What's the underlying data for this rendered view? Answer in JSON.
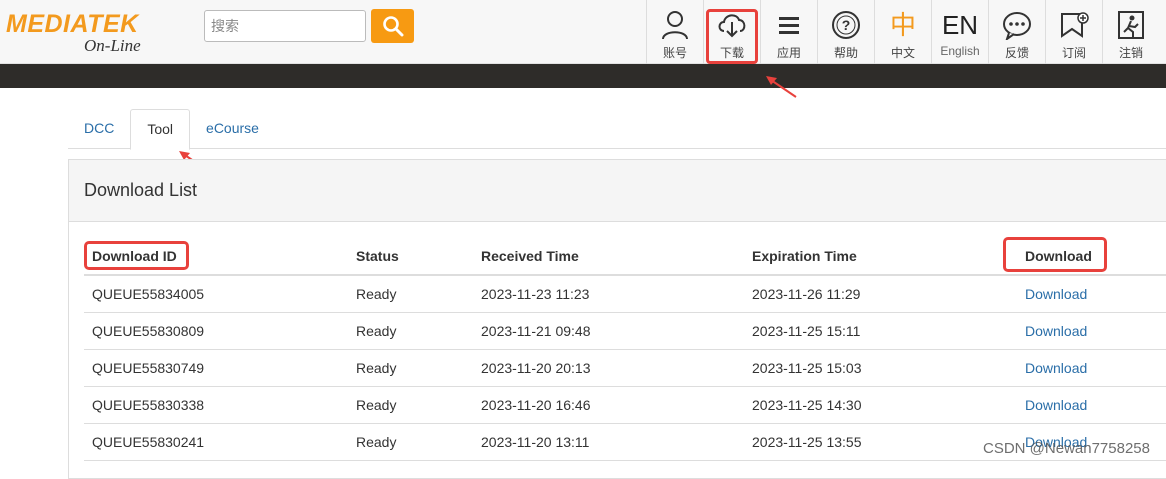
{
  "header": {
    "logo_main": "MEDIATEK",
    "logo_sub": "On-Line",
    "search_placeholder": "搜索",
    "nav": [
      {
        "label": "账号",
        "icon": "user-icon"
      },
      {
        "label": "下载",
        "icon": "cloud-download-icon"
      },
      {
        "label": "应用",
        "icon": "menu-icon"
      },
      {
        "label": "帮助",
        "icon": "help-icon"
      },
      {
        "label": "中文",
        "big": "中",
        "icon": "chinese-language-icon"
      },
      {
        "label": "English",
        "big": "EN",
        "icon": "english-language-icon"
      },
      {
        "label": "反馈",
        "icon": "feedback-icon"
      },
      {
        "label": "订阅",
        "icon": "subscribe-icon"
      },
      {
        "label": "注销",
        "icon": "logout-icon"
      }
    ]
  },
  "tabs": [
    "DCC",
    "Tool",
    "eCourse"
  ],
  "panel": {
    "title": "Download List",
    "columns": [
      "Download ID",
      "Status",
      "Received Time",
      "Expiration Time",
      "Download"
    ],
    "rows": [
      [
        "QUEUE55834005",
        "Ready",
        "2023-11-23 11:23",
        "2023-11-26 11:29",
        "Download"
      ],
      [
        "QUEUE55830809",
        "Ready",
        "2023-11-21 09:48",
        "2023-11-25 15:11",
        "Download"
      ],
      [
        "QUEUE55830749",
        "Ready",
        "2023-11-20 20:13",
        "2023-11-25 15:03",
        "Download"
      ],
      [
        "QUEUE55830338",
        "Ready",
        "2023-11-20 16:46",
        "2023-11-25 14:30",
        "Download"
      ],
      [
        "QUEUE55830241",
        "Ready",
        "2023-11-20 13:11",
        "2023-11-25 13:55",
        "Download"
      ]
    ]
  },
  "watermark": "CSDN @Newan7758258",
  "colors": {
    "brand": "#f39a1e",
    "link": "#2a6ea8",
    "highlight": "#e8413c",
    "band": "#2e2c29"
  }
}
